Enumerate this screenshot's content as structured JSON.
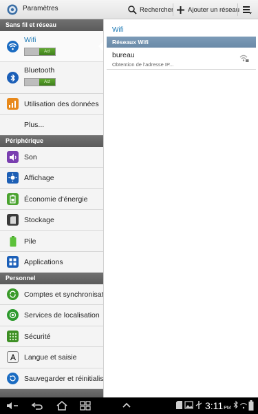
{
  "app": {
    "title": "Paramètres"
  },
  "actions": {
    "search_label": "Rechercher",
    "add_network_label": "Ajouter un réseau"
  },
  "sections": {
    "wireless": "Sans fil et réseau",
    "device": "Périphérique",
    "personal": "Personnel"
  },
  "items": {
    "wifi": {
      "label": "Wifi",
      "toggle": "Act"
    },
    "bluetooth": {
      "label": "Bluetooth",
      "toggle": "Act"
    },
    "data_usage": "Utilisation des données",
    "more": "Plus...",
    "sound": "Son",
    "display": "Affichage",
    "power": "Économie d'énergie",
    "storage": "Stockage",
    "battery": "Pile",
    "apps": "Applications",
    "accounts": "Comptes et synchronisation",
    "location": "Services de localisation",
    "security": "Sécurité",
    "language": "Langue et saisie",
    "backup": "Sauvegarder et réinitialiser"
  },
  "detail": {
    "title": "Wifi",
    "section": "Réseaux Wifi",
    "networks": [
      {
        "name": "bureau",
        "status": "Obtention de l'adresse IP..."
      }
    ]
  },
  "status_bar": {
    "time": "3:11",
    "ampm": "PM"
  },
  "colors": {
    "accent": "#1d7ab5",
    "toggle_on": "#4a8f22",
    "section_bg": "#626262"
  }
}
